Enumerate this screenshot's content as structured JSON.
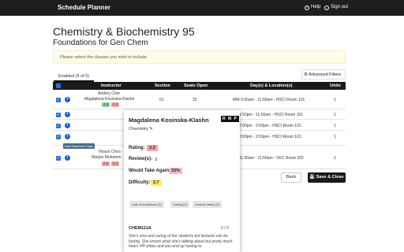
{
  "nav": {
    "brand": "Schedule Planner",
    "help": "Help",
    "signout": "Sign out"
  },
  "page": {
    "title": "Chemistry & Biochemistry 95",
    "subtitle": "Foundations for Gen Chem",
    "alert": "Please select the classes you wish to include"
  },
  "tabs": [
    {
      "label": "Enabled (5 of 5)"
    }
  ],
  "advanced_filters": "Advanced Filters",
  "table": {
    "headers": [
      "Instructor",
      "Section",
      "Seats Open",
      "Day(s) & Location(s)",
      "Units"
    ],
    "rows": [
      {
        "instructors": [
          "Andrey Chor",
          "Magdalena Kosinska-Klashn"
        ],
        "badges": [
          "4.4",
          "2.3"
        ],
        "section": "01",
        "seats": "23",
        "location": "MW 9:50am - 11:50am - HSCI Room 101",
        "units": "1"
      },
      {
        "instructors": [],
        "badges": [],
        "section": "",
        "seats": "",
        "location": "1:50pm - 11:50am - HSCI Room 101",
        "units": "1"
      },
      {
        "instructors": [],
        "badges": [],
        "section": "",
        "seats": "",
        "location": "2:00pm - 2:50pm - HSCI Room 101",
        "units": "1"
      },
      {
        "instructors": [],
        "badges": [],
        "section": "",
        "seats": "",
        "location": "2:00pm - 2:50pm - HSCI Room 101",
        "units": "1"
      },
      {
        "instructors": [
          "Hosun Choo",
          "Marjon Mohamm"
        ],
        "badges": [
          "2.5",
          "2.3"
        ],
        "section": "",
        "seats": "",
        "location": "11:00am - 11:50am - VEC Room 322",
        "units": "1"
      }
    ],
    "honors_badge": "Has Reserved Caps"
  },
  "buttons": {
    "back": "Back",
    "save": "Save & Close"
  },
  "popup": {
    "name": "Magdalena Kosinska-Klashn",
    "rmp": "R M P",
    "department": "Chemistry",
    "rating_label": "Rating:",
    "rating": "2.3",
    "reviews_label": "Review(s):",
    "reviews": "3",
    "would_take_label": "Would Take Again:",
    "would_take": "33%",
    "difficulty_label": "Difficulty:",
    "difficulty": "2.7",
    "tags": [
      "Lots of homework (1)",
      "Caring (1)",
      "Lecture heavy (2)"
    ],
    "course": "CHEM111A",
    "thumbs": "0 / 0",
    "review": "She's nice and caring of her students but lectures can be boring. She knows what she's talking about but pretty much hears HP slides and you end up having to"
  },
  "colors": {
    "nav": "#1e1e1e",
    "checkbox": "#2e6fe0",
    "info": "#1d5fc7",
    "badge_green": "#8fd19e",
    "badge_red": "#f6a3a8",
    "difficulty": "#ffe66b"
  }
}
